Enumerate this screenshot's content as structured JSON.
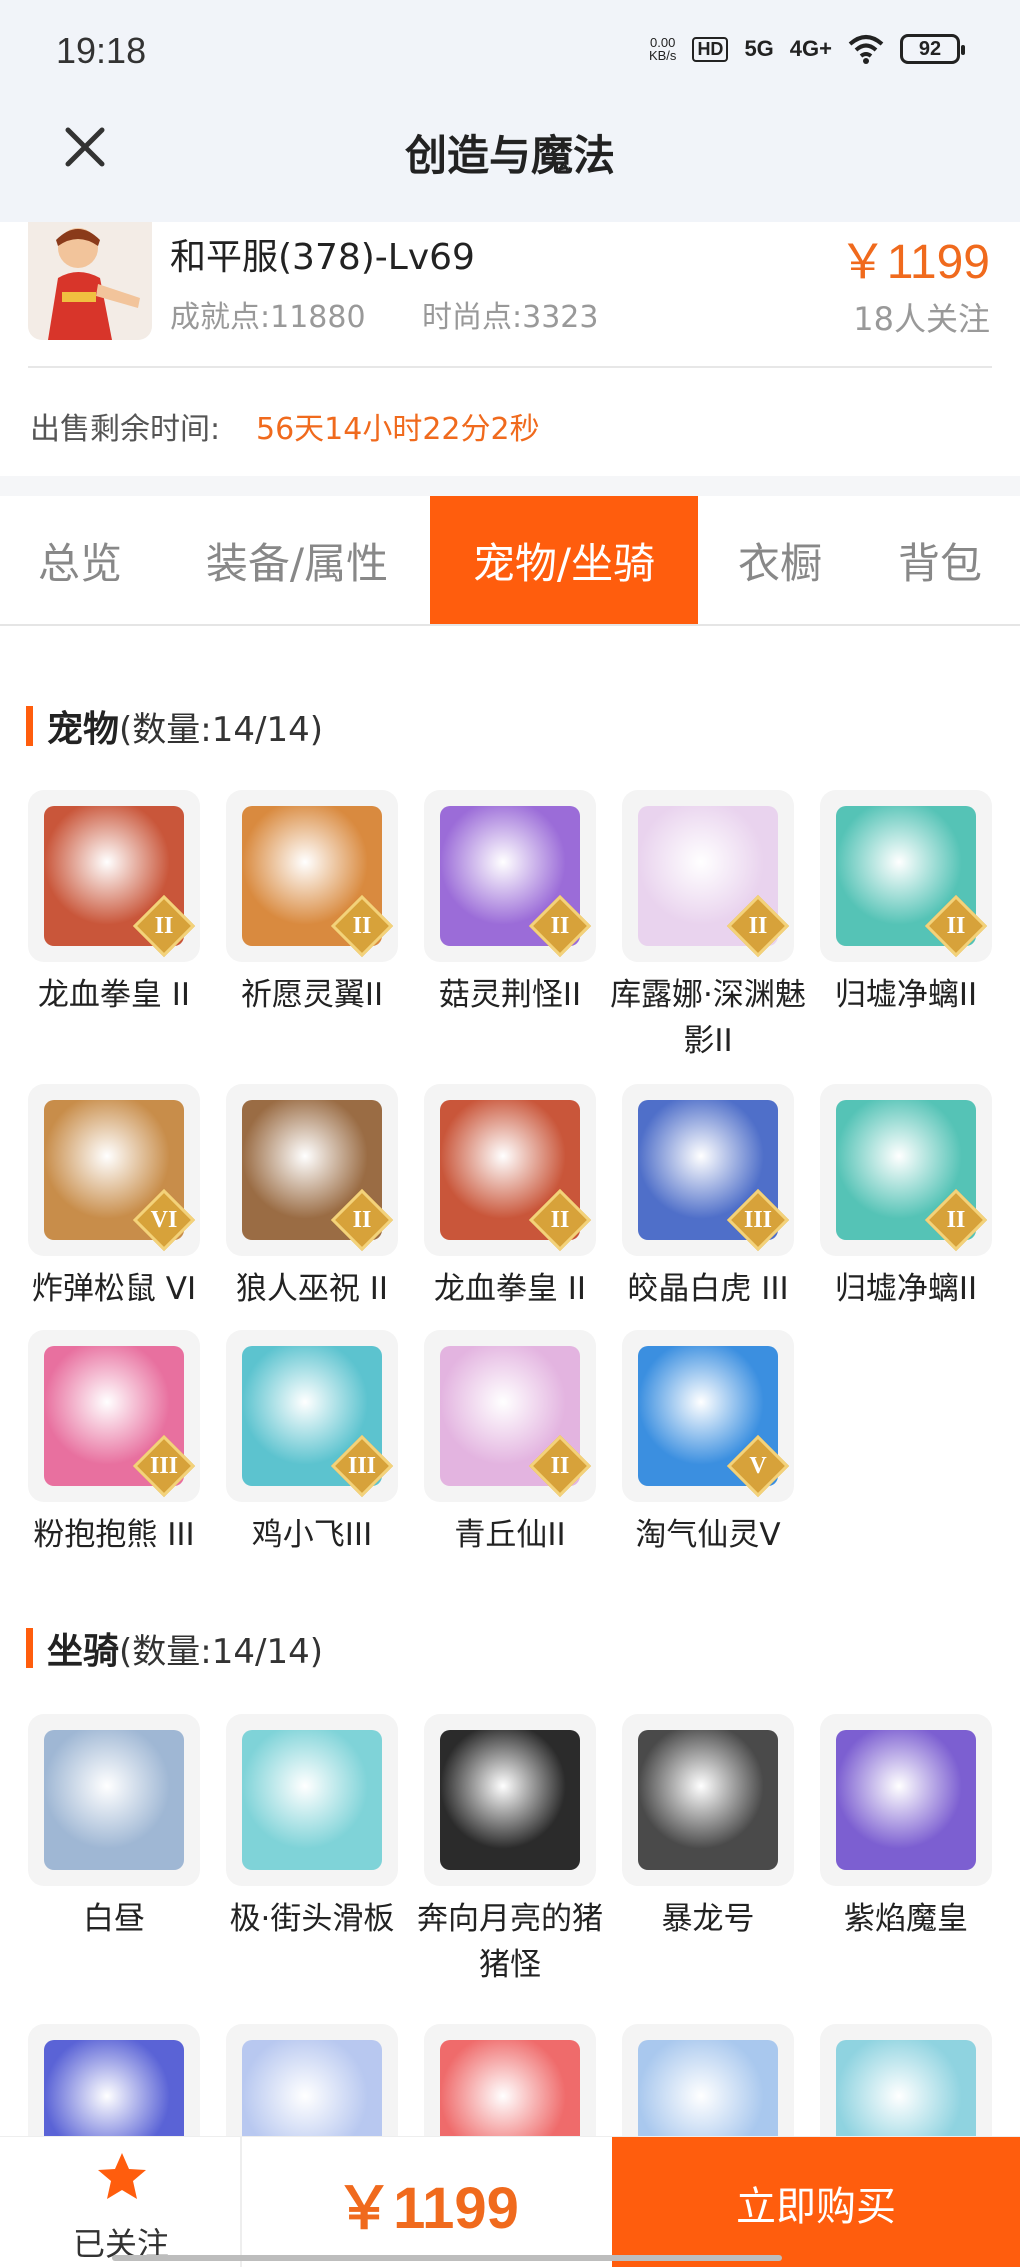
{
  "status_bar": {
    "time": "19:18",
    "net_speed": "0.00",
    "net_unit": "KB/s",
    "hd": "HD",
    "sig1": "5G",
    "sig2": "4G+",
    "battery": "92"
  },
  "header": {
    "title": "创造与魔法"
  },
  "product": {
    "name": "和平服(378)-Lv69",
    "achievement": "成就点:11880",
    "fashion": "时尚点:3323",
    "price": "￥1199",
    "followers": "18人关注",
    "timer_label": "出售剩余时间:",
    "timer_value": "56天14小时22分2秒"
  },
  "tabs": [
    {
      "label": "总览",
      "active": false
    },
    {
      "label": "装备/属性",
      "active": false
    },
    {
      "label": "宠物/坐骑",
      "active": true
    },
    {
      "label": "衣橱",
      "active": false
    },
    {
      "label": "背包",
      "active": false
    }
  ],
  "pets": {
    "title": "宠物",
    "count": "(数量:14/14)",
    "items": [
      {
        "name": "龙血拳皇 II",
        "rank": "II",
        "color": "#c9563a"
      },
      {
        "name": "祈愿灵翼II",
        "rank": "II",
        "color": "#d98a3f"
      },
      {
        "name": "菇灵荆怪II",
        "rank": "II",
        "color": "#9b6cd8"
      },
      {
        "name": "库露娜·深渊魅影II",
        "rank": "II",
        "color": "#e9d3ee"
      },
      {
        "name": "归墟净螭II",
        "rank": "II",
        "color": "#55c3b6"
      },
      {
        "name": "炸弹松鼠 VI",
        "rank": "VI",
        "color": "#c88d4a"
      },
      {
        "name": "狼人巫祝 II",
        "rank": "II",
        "color": "#9a6c44"
      },
      {
        "name": "龙血拳皇 II",
        "rank": "II",
        "color": "#c9563a"
      },
      {
        "name": "皎晶白虎 III",
        "rank": "III",
        "color": "#4f6fc9"
      },
      {
        "name": "归墟净螭II",
        "rank": "II",
        "color": "#55c3b6"
      },
      {
        "name": "粉抱抱熊 III",
        "rank": "III",
        "color": "#e8709f"
      },
      {
        "name": "鸡小飞III",
        "rank": "III",
        "color": "#5cc3cf"
      },
      {
        "name": "青丘仙II",
        "rank": "II",
        "color": "#e3b4e0"
      },
      {
        "name": "淘气仙灵V",
        "rank": "V",
        "color": "#3b8fe0"
      }
    ]
  },
  "mounts": {
    "title": "坐骑",
    "count": "(数量:14/14)",
    "items": [
      {
        "name": "白昼",
        "color": "#9fb7d4"
      },
      {
        "name": "极·街头滑板",
        "color": "#7fd3d8"
      },
      {
        "name": "奔向月亮的猪猪怪",
        "color": "#2b2b2b"
      },
      {
        "name": "暴龙号",
        "color": "#4a4a4a"
      },
      {
        "name": "紫焰魔皇",
        "color": "#7c5fd1"
      },
      {
        "name": "",
        "color": "#5a63d6"
      },
      {
        "name": "",
        "color": "#b8c8f0"
      },
      {
        "name": "",
        "color": "#ef6b6b"
      },
      {
        "name": "",
        "color": "#a9c8ee"
      },
      {
        "name": "",
        "color": "#8fd3e0"
      }
    ]
  },
  "bottom": {
    "follow_label": "已关注",
    "price": "￥1199",
    "buy_label": "立即购买"
  },
  "colors": {
    "accent": "#ff5d0d",
    "price": "#f06a1d",
    "rank_gold": "#d7a23a"
  }
}
